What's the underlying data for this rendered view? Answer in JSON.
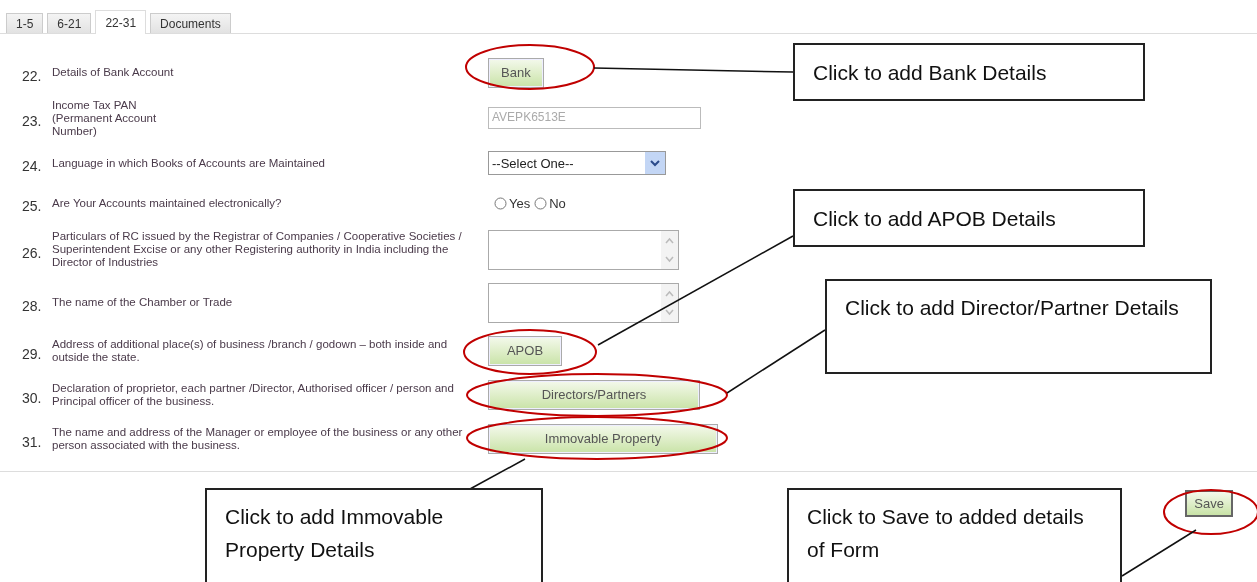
{
  "tabs": [
    {
      "label": "1-5",
      "selected": false
    },
    {
      "label": "6-21",
      "selected": false
    },
    {
      "label": "22-31",
      "selected": true
    },
    {
      "label": "Documents",
      "selected": false
    }
  ],
  "fields": [
    {
      "number": "22.",
      "label": "Details of Bank Account",
      "kind": "button",
      "button": "Bank"
    },
    {
      "number": "23.",
      "label": "Income Tax PAN (Permanent Account Number)",
      "kind": "text",
      "value": "AVEPK6513E",
      "disabled": true
    },
    {
      "number": "24.",
      "label": "Language in which Books of Accounts are Maintained",
      "kind": "select",
      "value": "--Select One--"
    },
    {
      "number": "25.",
      "label": "Are Your Accounts maintained electronically?",
      "kind": "radio",
      "options": [
        {
          "label": "Yes",
          "selected": false
        },
        {
          "label": "No",
          "selected": false
        }
      ]
    },
    {
      "number": "26.",
      "label": "Particulars of RC issued by the Registrar of Companies / Cooperative Societies / Superintendent Excise or any other Registering authority in India including the Director of Industries",
      "kind": "textarea"
    },
    {
      "number": "28.",
      "label": "The name of the Chamber or Trade",
      "kind": "textarea"
    },
    {
      "number": "29.",
      "label": "Address of additional place(s) of business /branch / godown – both inside and outside the state.",
      "kind": "button",
      "button": "APOB"
    },
    {
      "number": "30.",
      "label": "Declaration of proprietor, each partner /Director, Authorised officer / person and Principal officer of the business.",
      "kind": "button",
      "button": "Directors/Partners"
    },
    {
      "number": "31.",
      "label": "The name and address of the Manager or employee of the business or any other person associated with the business.",
      "kind": "button",
      "button": "Immovable Property"
    }
  ],
  "save_button": "Save",
  "callouts": [
    {
      "text": "Click to add Bank Details"
    },
    {
      "text": "Click to add APOB Details"
    },
    {
      "text": "Click to add Director/Partner Details"
    },
    {
      "text": "Click to add Immovable Property Details"
    },
    {
      "text": "Click to Save to added details of Form"
    }
  ]
}
